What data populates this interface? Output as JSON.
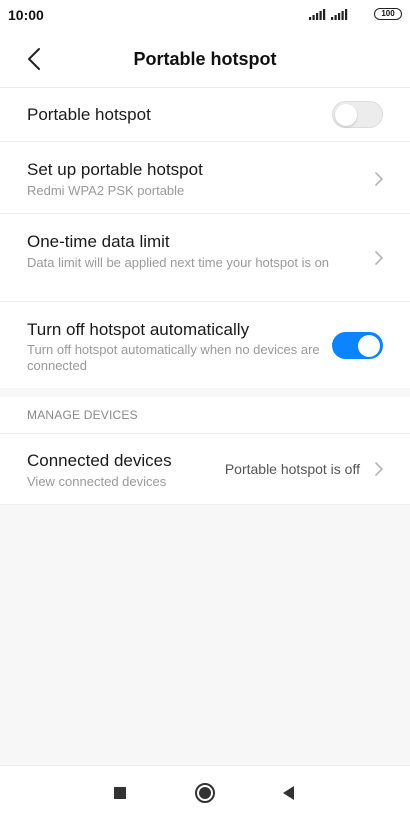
{
  "status_bar": {
    "time": "10:00",
    "battery": "100"
  },
  "header": {
    "title": "Portable hotspot"
  },
  "settings": {
    "hotspot": {
      "title": "Portable hotspot",
      "enabled": false
    },
    "setup": {
      "title": "Set up portable hotspot",
      "subtitle": "Redmi WPA2 PSK portable"
    },
    "data_limit": {
      "title": "One-time data limit",
      "subtitle": "Data limit will be applied next time your hotspot is on"
    },
    "auto_off": {
      "title": "Turn off hotspot automatically",
      "subtitle": "Turn off hotspot automatically when no devices are connected",
      "enabled": true
    }
  },
  "manage_devices": {
    "section_label": "MANAGE DEVICES",
    "connected": {
      "title": "Connected devices",
      "subtitle": "View connected devices",
      "value": "Portable hotspot is off"
    }
  },
  "colors": {
    "accent": "#0d84ff",
    "toggle_off": "#ececec"
  },
  "icons": [
    "back-arrow-icon",
    "chevron-right-icon",
    "signal-icon",
    "battery-icon",
    "square-icon",
    "circle-icon",
    "triangle-back-icon"
  ]
}
